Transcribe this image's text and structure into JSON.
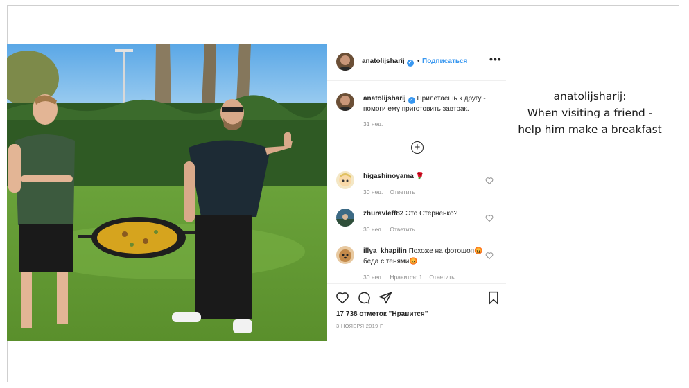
{
  "post": {
    "username": "anatolijsharij",
    "verified_mark": "✓",
    "separator": "•",
    "follow_label": "Подписаться",
    "more_label": "•••",
    "caption_text": "Прилетаешь к другу - помоги ему приготовить завтрак.",
    "caption_time": "31 нед.",
    "load_more_label": "+",
    "comments": [
      {
        "username": "higashinoyama",
        "text": "🌹",
        "time": "30 нед.",
        "reply": "Ответить",
        "likes": ""
      },
      {
        "username": "zhuravleff82",
        "text": "Это Стерненко?",
        "time": "30 нед.",
        "reply": "Ответить",
        "likes": ""
      },
      {
        "username": "illya_khapilin",
        "text": "Похоже на фотошоп😡 беда с тенями😡",
        "time": "30 нед.",
        "reply": "Ответить",
        "likes": "Нравится: 1"
      }
    ],
    "likes_text": "17 738 отметок \"Нравится\"",
    "date_text": "3 НОЯБРЯ 2019 Г.",
    "icons": [
      "heart-icon",
      "comment-icon",
      "share-icon",
      "bookmark-icon",
      "three-dots-icon",
      "plus-circle-icon",
      "verified-icon"
    ]
  },
  "translation": {
    "line1": "anatolijsharij:",
    "line2": "When visiting a friend -",
    "line3": "help him make a breakfast"
  },
  "colors": {
    "accent": "#3897f0",
    "muted": "#8e8e8e",
    "text": "#262626"
  }
}
